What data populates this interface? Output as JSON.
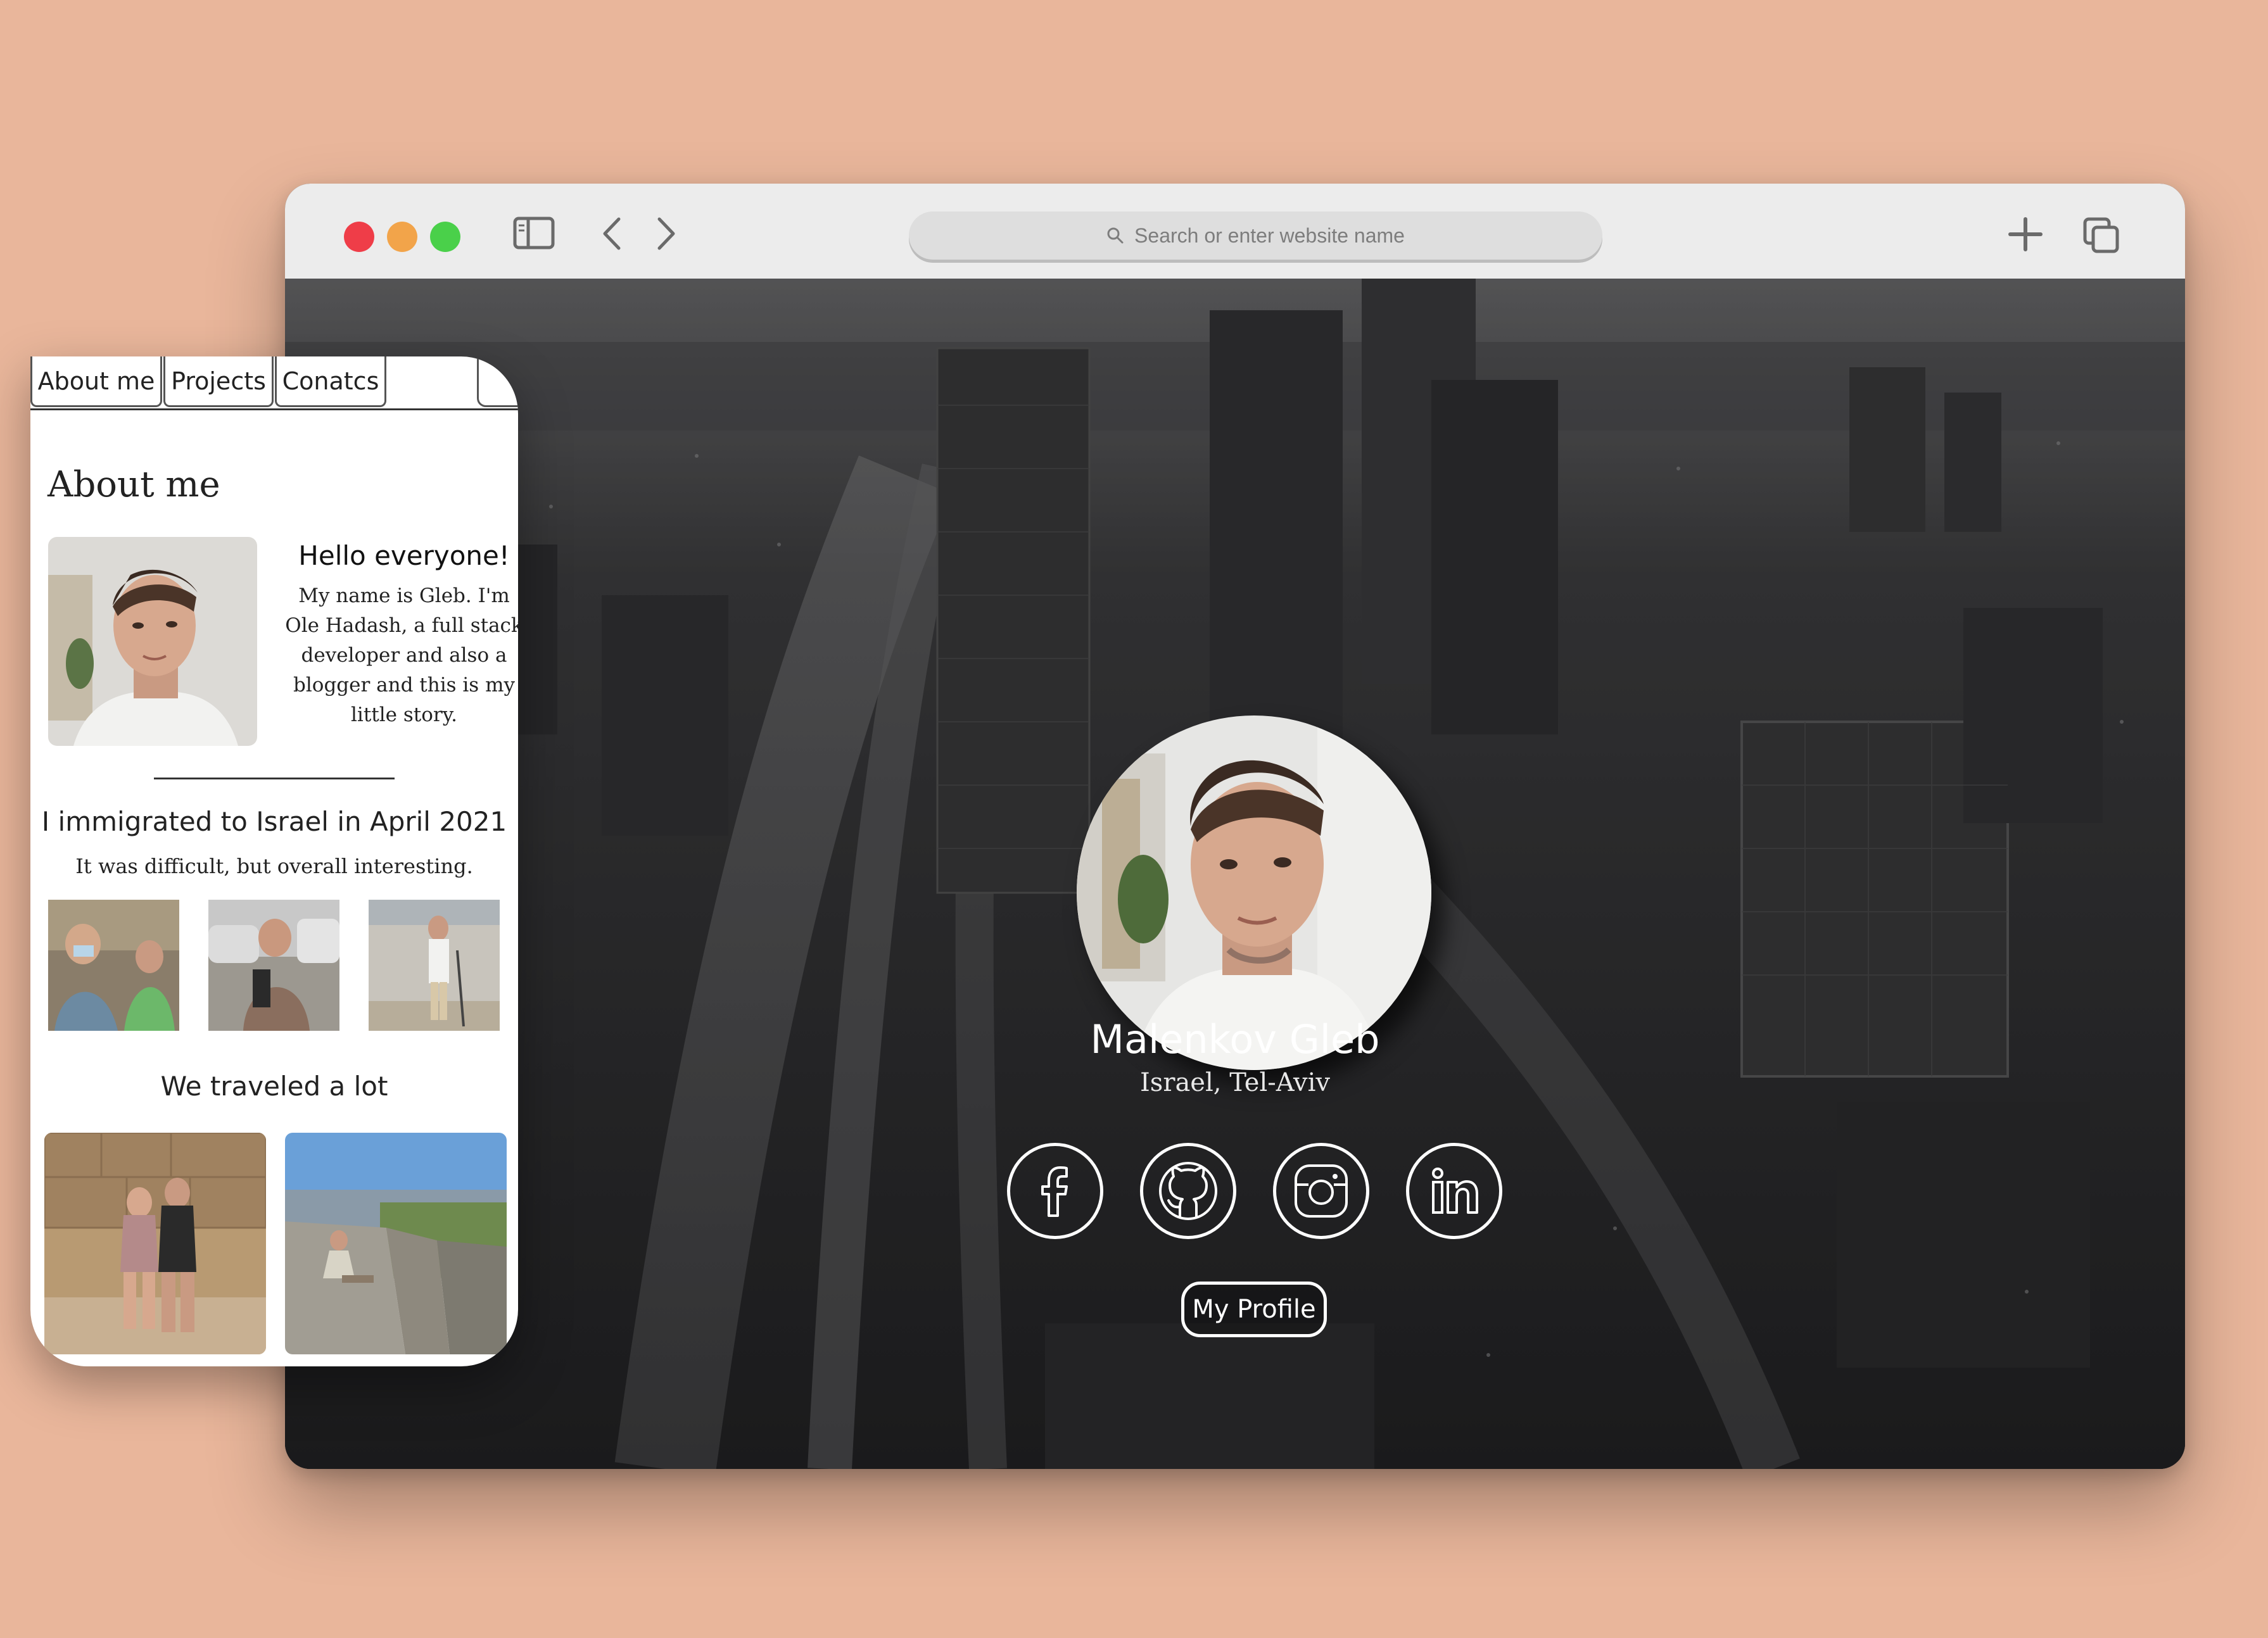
{
  "browser": {
    "search_placeholder": "Search or enter website name"
  },
  "hero": {
    "name": "Malenkov Gleb",
    "location": "Israel, Tel-Aviv",
    "social": [
      "facebook-icon",
      "github-icon",
      "instagram-icon",
      "linkedin-icon"
    ],
    "profile_button": "My Profile"
  },
  "phone": {
    "tabs": [
      "About me",
      "Projects",
      "Conatcs"
    ],
    "title": "About me",
    "hello": "Hello everyone!",
    "intro": "My name is Gleb. I'm Ole Hadash, a full stack developer and also a blogger and this is my little story.",
    "immigrated": "I immigrated to Israel in April 2021",
    "difficult": "It was difficult, but overall interesting.",
    "traveled": "We traveled a lot"
  },
  "colors": {
    "page_background": "#e9b69b",
    "toolbar": "#ececec",
    "close": "#ef3d48",
    "minimize": "#f2a44a",
    "maximize": "#4ad04a"
  }
}
